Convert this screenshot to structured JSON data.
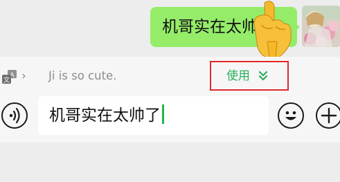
{
  "message": {
    "text": "机哥实在太帅了",
    "bubble_color": "#95ec69"
  },
  "avatar": {
    "icon": "avatar-photo"
  },
  "pointer": {
    "icon": "pointing-hand-emoji"
  },
  "translation": {
    "icon": "translate-icon",
    "chevron": "›",
    "text": "Ji is so cute.",
    "use_label": "使用",
    "use_icon": "double-chevron-down-icon",
    "accent": "#2bae5a",
    "highlight": "#e3262a"
  },
  "input": {
    "value": "机哥实在太帅了",
    "voice_icon": "voice-icon",
    "emoji_icon": "emoji-icon",
    "plus_icon": "plus-icon",
    "caret_color": "#21b54a"
  }
}
